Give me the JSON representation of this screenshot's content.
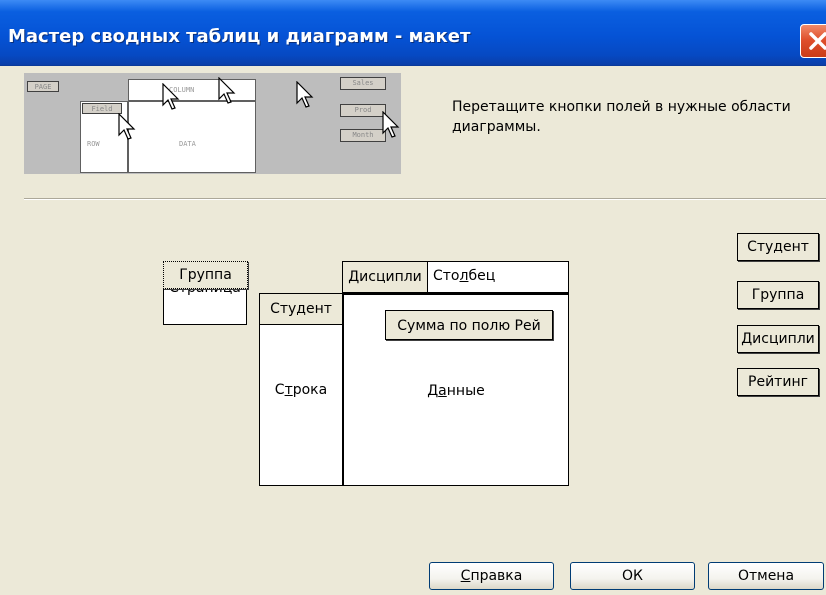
{
  "window": {
    "title": "Мастер сводных таблиц и диаграмм - макет"
  },
  "preview": {
    "page_label": "PAGE",
    "row_label": "ROW",
    "column_label": "COLUMN",
    "data_label": "DATA",
    "field1_label": "Field",
    "field2_label": "Field",
    "sales_label": "Sales",
    "prod_label": "Prod",
    "month_label": "Month"
  },
  "instruction_text": "Перетащите кнопки полей в нужные области диаграммы.",
  "layout": {
    "page_area": {
      "label": "Страница",
      "field": "Группа"
    },
    "row_area": {
      "label_pre": "С",
      "label_ul": "т",
      "label_post": "рока",
      "field": "Студент"
    },
    "column_area": {
      "label_pre": "Сто",
      "label_ul": "л",
      "label_post": "бец",
      "field": "Дисципли"
    },
    "data_area": {
      "label_pre": "Д",
      "label_ul": "а",
      "label_post": "нные",
      "field": "Сумма по полю Рей"
    }
  },
  "field_list": [
    "Студент",
    "Группа",
    "Дисципли",
    "Рейтинг"
  ],
  "buttons": {
    "help_ul": "С",
    "help_rest": "правка",
    "ok": "ОК",
    "cancel": "Отмена"
  },
  "colors": {
    "title_bar": "#0553d6",
    "dialog_bg": "#ece9d8",
    "close_button": "#e0502d"
  }
}
